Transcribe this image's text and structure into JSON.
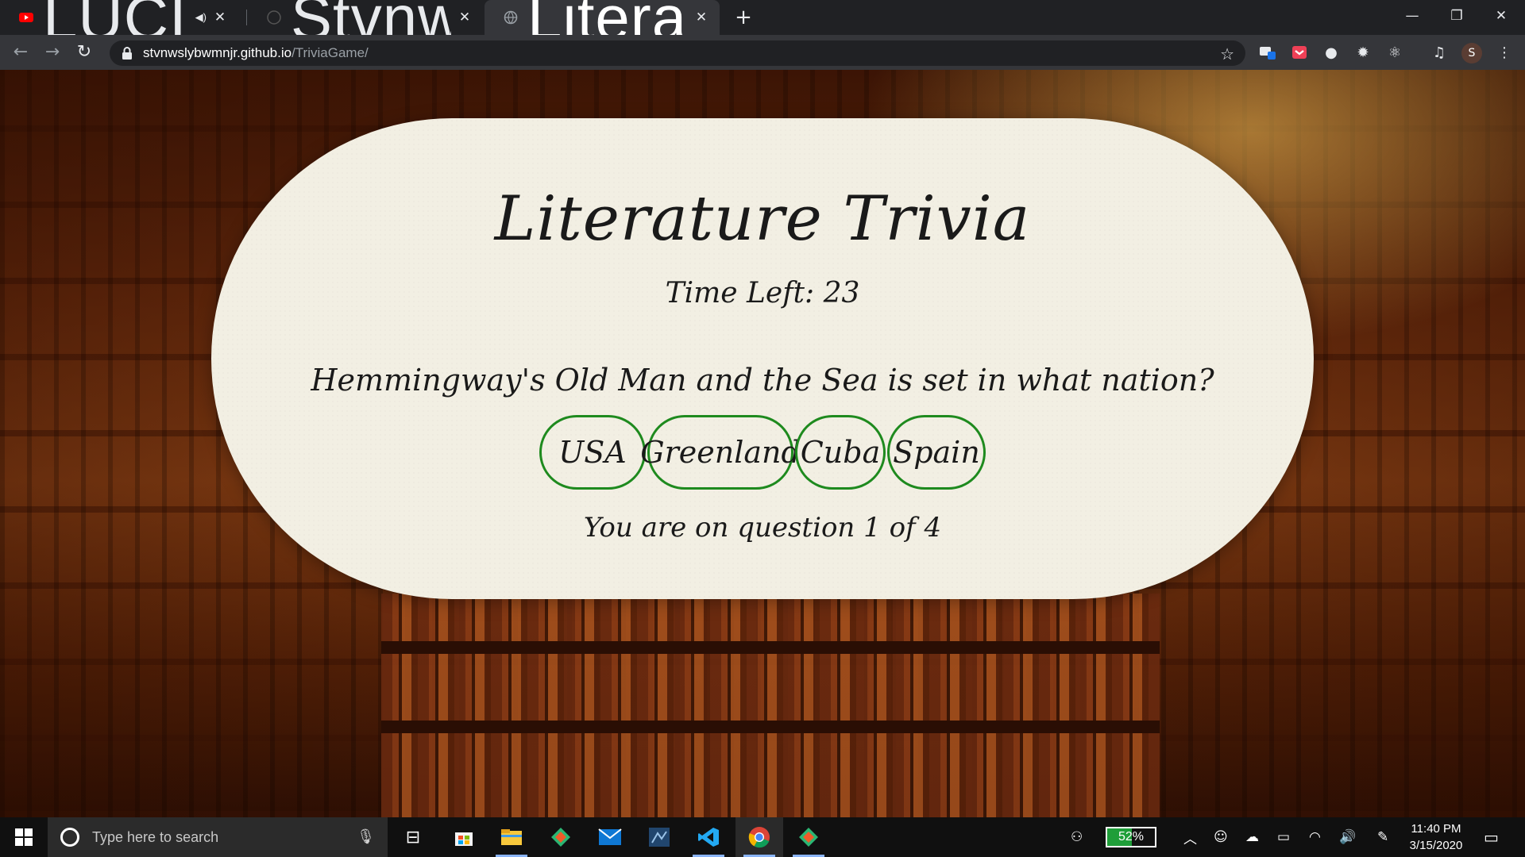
{
  "browser": {
    "tabs": [
      {
        "title": "LUCIFER - Dreamer (OFFICIAL",
        "active": false,
        "icon": "youtube-icon",
        "audio": true
      },
      {
        "title": "Stvnwslybwmnjr/TriviaGame",
        "active": false,
        "icon": "github-icon"
      },
      {
        "title": "Literature Trivia",
        "active": true,
        "icon": "globe-icon"
      }
    ],
    "address": {
      "host": "stvnwslybwmnjr.github.io",
      "path": "/TriviaGame/"
    },
    "profile_initial": "S"
  },
  "game": {
    "title": "Literature Trivia",
    "timer_label": "Time Left:",
    "timer_value": "23",
    "question": "Hemmingway's Old Man and the Sea is set in what nation?",
    "answers": [
      "USA",
      "Greenland",
      "Cuba",
      "Spain"
    ],
    "progress_text": "You are on question 1 of 4",
    "accent_color": "#1e8a1e"
  },
  "taskbar": {
    "search_placeholder": "Type here to search",
    "battery": {
      "percent_label": "52%",
      "level": 0.52
    },
    "time": "11:40 PM",
    "date": "3/15/2020"
  }
}
